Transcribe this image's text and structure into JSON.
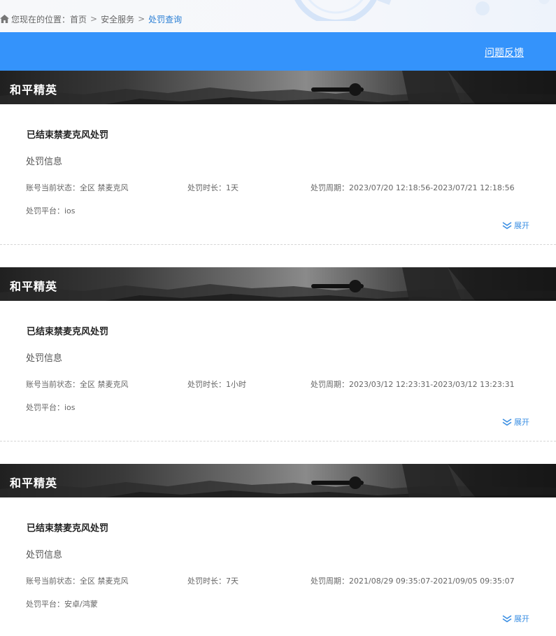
{
  "breadcrumb": {
    "prefix": "您现在的位置：",
    "items": [
      "首页",
      "安全服务",
      "处罚查询"
    ],
    "separator": ">"
  },
  "header": {
    "feedback_label": "问题反馈",
    "accent_color": "#3493fb"
  },
  "records": [
    {
      "game": "和平精英",
      "title": "已结束禁麦克风处罚",
      "subtitle": "处罚信息",
      "status": "账号当前状态：全区 禁麦克风",
      "duration": "处罚时长：1天",
      "period": "处罚周期：2023/07/20 12:18:56-2023/07/21 12:18:56",
      "platform": "处罚平台：ios",
      "expand_label": "展开"
    },
    {
      "game": "和平精英",
      "title": "已结束禁麦克风处罚",
      "subtitle": "处罚信息",
      "status": "账号当前状态：全区 禁麦克风",
      "duration": "处罚时长：1小时",
      "period": "处罚周期：2023/03/12 12:23:31-2023/03/12 13:23:31",
      "platform": "处罚平台：ios",
      "expand_label": "展开"
    },
    {
      "game": "和平精英",
      "title": "已结束禁麦克风处罚",
      "subtitle": "处罚信息",
      "status": "账号当前状态：全区 禁麦克风",
      "duration": "处罚时长：7天",
      "period": "处罚周期：2021/08/29 09:35:07-2021/09/05 09:35:07",
      "platform": "处罚平台：安卓/鸿蒙",
      "expand_label": "展开"
    }
  ]
}
